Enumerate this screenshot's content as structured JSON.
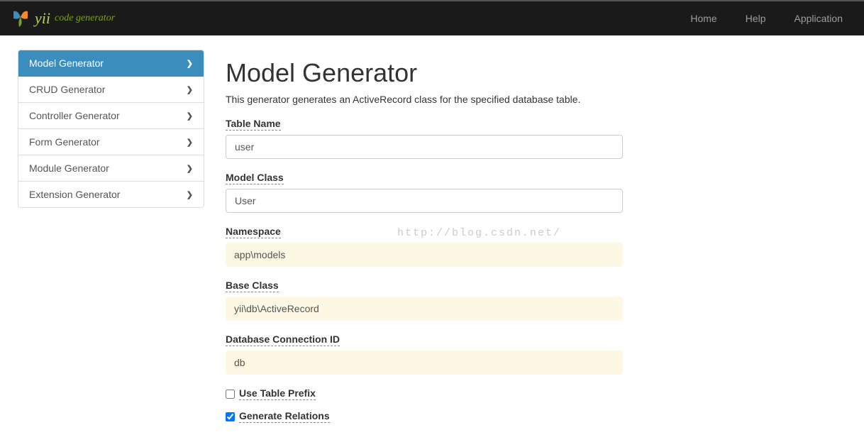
{
  "brand": {
    "name": "yii",
    "tagline": "code generator"
  },
  "nav": {
    "home": "Home",
    "help": "Help",
    "application": "Application"
  },
  "sidebar": {
    "items": [
      {
        "label": "Model Generator",
        "active": true
      },
      {
        "label": "CRUD Generator",
        "active": false
      },
      {
        "label": "Controller Generator",
        "active": false
      },
      {
        "label": "Form Generator",
        "active": false
      },
      {
        "label": "Module Generator",
        "active": false
      },
      {
        "label": "Extension Generator",
        "active": false
      }
    ]
  },
  "page": {
    "title": "Model Generator",
    "description": "This generator generates an ActiveRecord class for the specified database table."
  },
  "form": {
    "tableName": {
      "label": "Table Name",
      "value": "user"
    },
    "modelClass": {
      "label": "Model Class",
      "value": "User"
    },
    "namespace": {
      "label": "Namespace",
      "value": "app\\models"
    },
    "baseClass": {
      "label": "Base Class",
      "value": "yii\\db\\ActiveRecord"
    },
    "dbConnectionId": {
      "label": "Database Connection ID",
      "value": "db"
    },
    "useTablePrefix": {
      "label": "Use Table Prefix",
      "checked": false
    },
    "generateRelations": {
      "label": "Generate Relations",
      "checked": true
    }
  },
  "watermark": "http://blog.csdn.net/"
}
